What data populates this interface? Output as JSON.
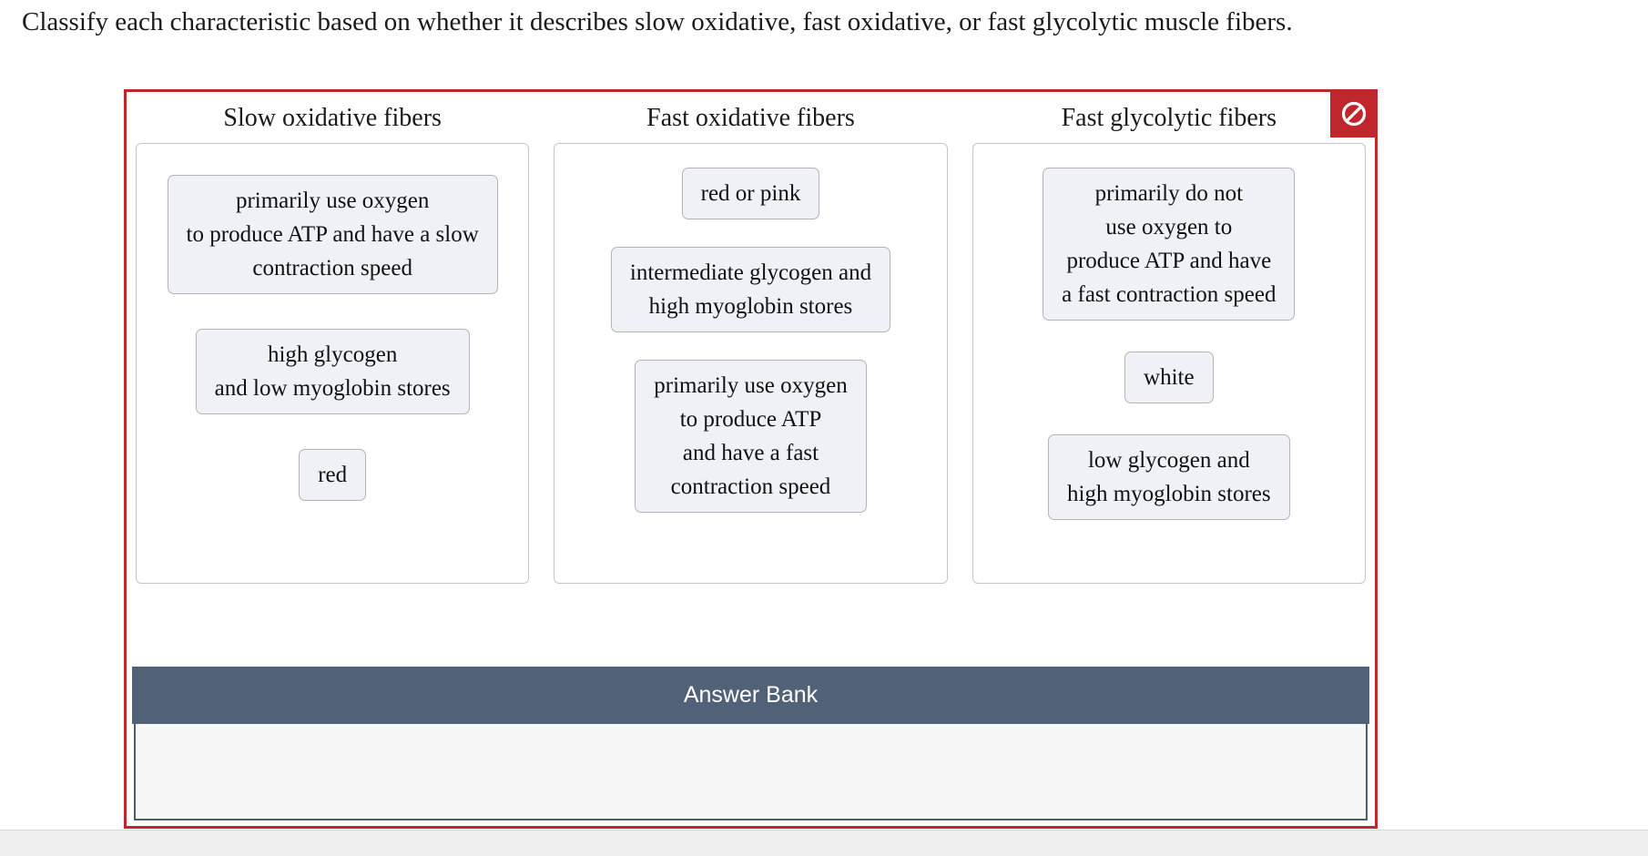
{
  "question": {
    "prompt": "Classify each characteristic based on whether it describes slow oxidative, fast oxidative, or fast glycolytic muscle fibers."
  },
  "frame": {
    "border_color": "#c0272d",
    "badge": {
      "icon": "no-entry-icon",
      "background": "#c0272d",
      "glyph_color": "#ffffff"
    }
  },
  "categories": [
    {
      "id": "slow-oxidative",
      "title": "Slow oxidative fibers",
      "tiles": [
        {
          "id": "so-tile-1",
          "lines": [
            "primarily use oxygen",
            "to produce ATP and have a slow",
            "contraction speed"
          ]
        },
        {
          "id": "so-tile-2",
          "lines": [
            "high glycogen",
            "and low myoglobin stores"
          ]
        },
        {
          "id": "so-tile-3",
          "lines": [
            "red"
          ]
        }
      ]
    },
    {
      "id": "fast-oxidative",
      "title": "Fast oxidative fibers",
      "tiles": [
        {
          "id": "fo-tile-1",
          "lines": [
            "red or pink"
          ]
        },
        {
          "id": "fo-tile-2",
          "lines": [
            "intermediate glycogen and",
            "high myoglobin stores"
          ]
        },
        {
          "id": "fo-tile-3",
          "lines": [
            "primarily use oxygen",
            "to produce ATP",
            "and have a fast",
            "contraction speed"
          ]
        }
      ]
    },
    {
      "id": "fast-glycolytic",
      "title": "Fast glycolytic fibers",
      "tiles": [
        {
          "id": "fg-tile-1",
          "lines": [
            "primarily do not",
            "use oxygen to",
            "produce ATP and have",
            "a fast contraction speed"
          ]
        },
        {
          "id": "fg-tile-2",
          "lines": [
            "white"
          ]
        },
        {
          "id": "fg-tile-3",
          "lines": [
            "low glycogen and",
            "high myoglobin stores"
          ]
        }
      ]
    }
  ],
  "answer_bank": {
    "label": "Answer Bank",
    "header_color": "#506178",
    "body_color": "#f7f7f8",
    "items": []
  }
}
